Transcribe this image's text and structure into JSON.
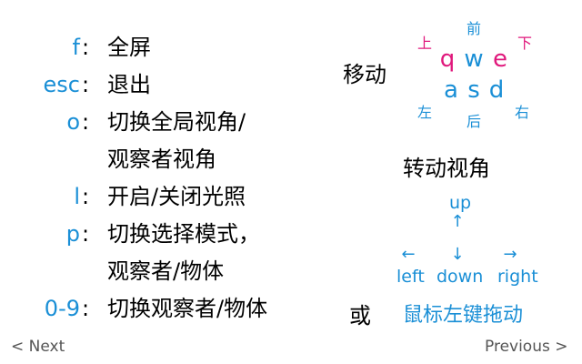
{
  "bindings": [
    {
      "key": "f",
      "colon": ":",
      "desc": "全屏"
    },
    {
      "key": "esc",
      "colon": ":",
      "desc": "退出"
    },
    {
      "key": "o",
      "colon": ":",
      "desc": "切换全局视角/",
      "desc2": "观察者视角"
    },
    {
      "key": "l",
      "colon": ":",
      "desc": "开启/关闭光照"
    },
    {
      "key": "p",
      "colon": ":",
      "desc": "切换选择模式，",
      "desc2": "观察者/物体"
    },
    {
      "key": "0-9",
      "colon": ":",
      "desc": "切换观察者/物体"
    }
  ],
  "move": {
    "label": "移动",
    "keys": {
      "q": "q",
      "w": "w",
      "e": "e",
      "a": "a",
      "s": "s",
      "d": "d"
    },
    "dirs": {
      "front": "前",
      "up": "上",
      "down": "下",
      "left": "左",
      "back": "后",
      "right": "右"
    }
  },
  "rotate": {
    "label": "转动视角",
    "up_arrow": "↑",
    "up_label": "up",
    "left_arrow": "←",
    "down_arrow": "↓",
    "right_arrow": "→",
    "left_label": "left",
    "down_label": "down",
    "right_label": "right",
    "or_label": "或",
    "mouse_label": "鼠标左键拖动"
  },
  "nav": {
    "next": "< Next",
    "previous": "Previous >"
  },
  "colors": {
    "key_blue": "#1a8fd6",
    "accent_pink": "#e0187c",
    "nav_gray": "#555555"
  }
}
